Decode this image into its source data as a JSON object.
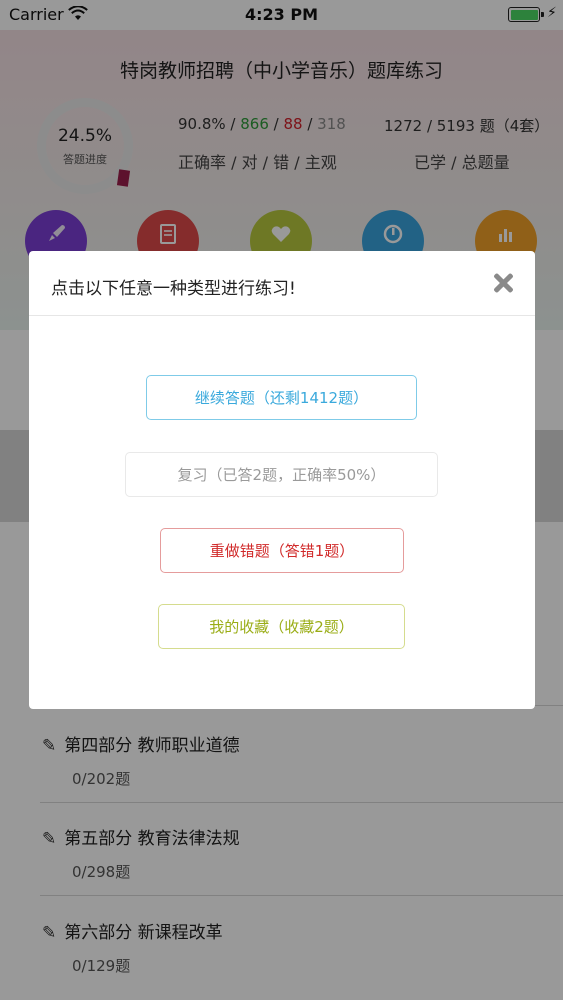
{
  "status_bar": {
    "carrier": "Carrier",
    "time": "4:23 PM"
  },
  "header": {
    "title": "特岗教师招聘（中小学音乐）题库练习",
    "progress": {
      "percent": "24.5%",
      "label": "答题进度",
      "value": 0.245
    },
    "accuracy": {
      "rate": "90.8%",
      "correct": "866",
      "wrong": "88",
      "subjective": "318",
      "sep": " / ",
      "label": "正确率 / 对 / 错 / 主观"
    },
    "learned": {
      "value": "1272 / 5193 题（4套）",
      "label": "已学 / 总题量"
    },
    "icons": [
      "rocket-icon",
      "document-icon",
      "heart-icon",
      "refresh-icon",
      "chart-icon"
    ],
    "colors": {
      "purple": "#7c3ed6",
      "red": "#de4a4a",
      "lime": "#b8c93e",
      "blue": "#3aa4de",
      "orange": "#f0a128"
    }
  },
  "list": [
    {
      "title": "第四部分 教师职业道德",
      "count": "0/202题"
    },
    {
      "title": "第五部分 教育法律法规",
      "count": "0/298题"
    },
    {
      "title": "第六部分 新课程改革",
      "count": "0/129题"
    }
  ],
  "dialog": {
    "title": "点击以下任意一种类型进行练习!",
    "options": [
      {
        "label": "继续答题（还剩1412题）",
        "color": "#3aa9dc"
      },
      {
        "label": "复习（已答2题，正确率50%）",
        "color": "#9a9a9a"
      },
      {
        "label": "重做错题（答错1题）",
        "color": "#d12a2a"
      },
      {
        "label": "我的收藏（收藏2题）",
        "color": "#9aad16"
      }
    ]
  }
}
